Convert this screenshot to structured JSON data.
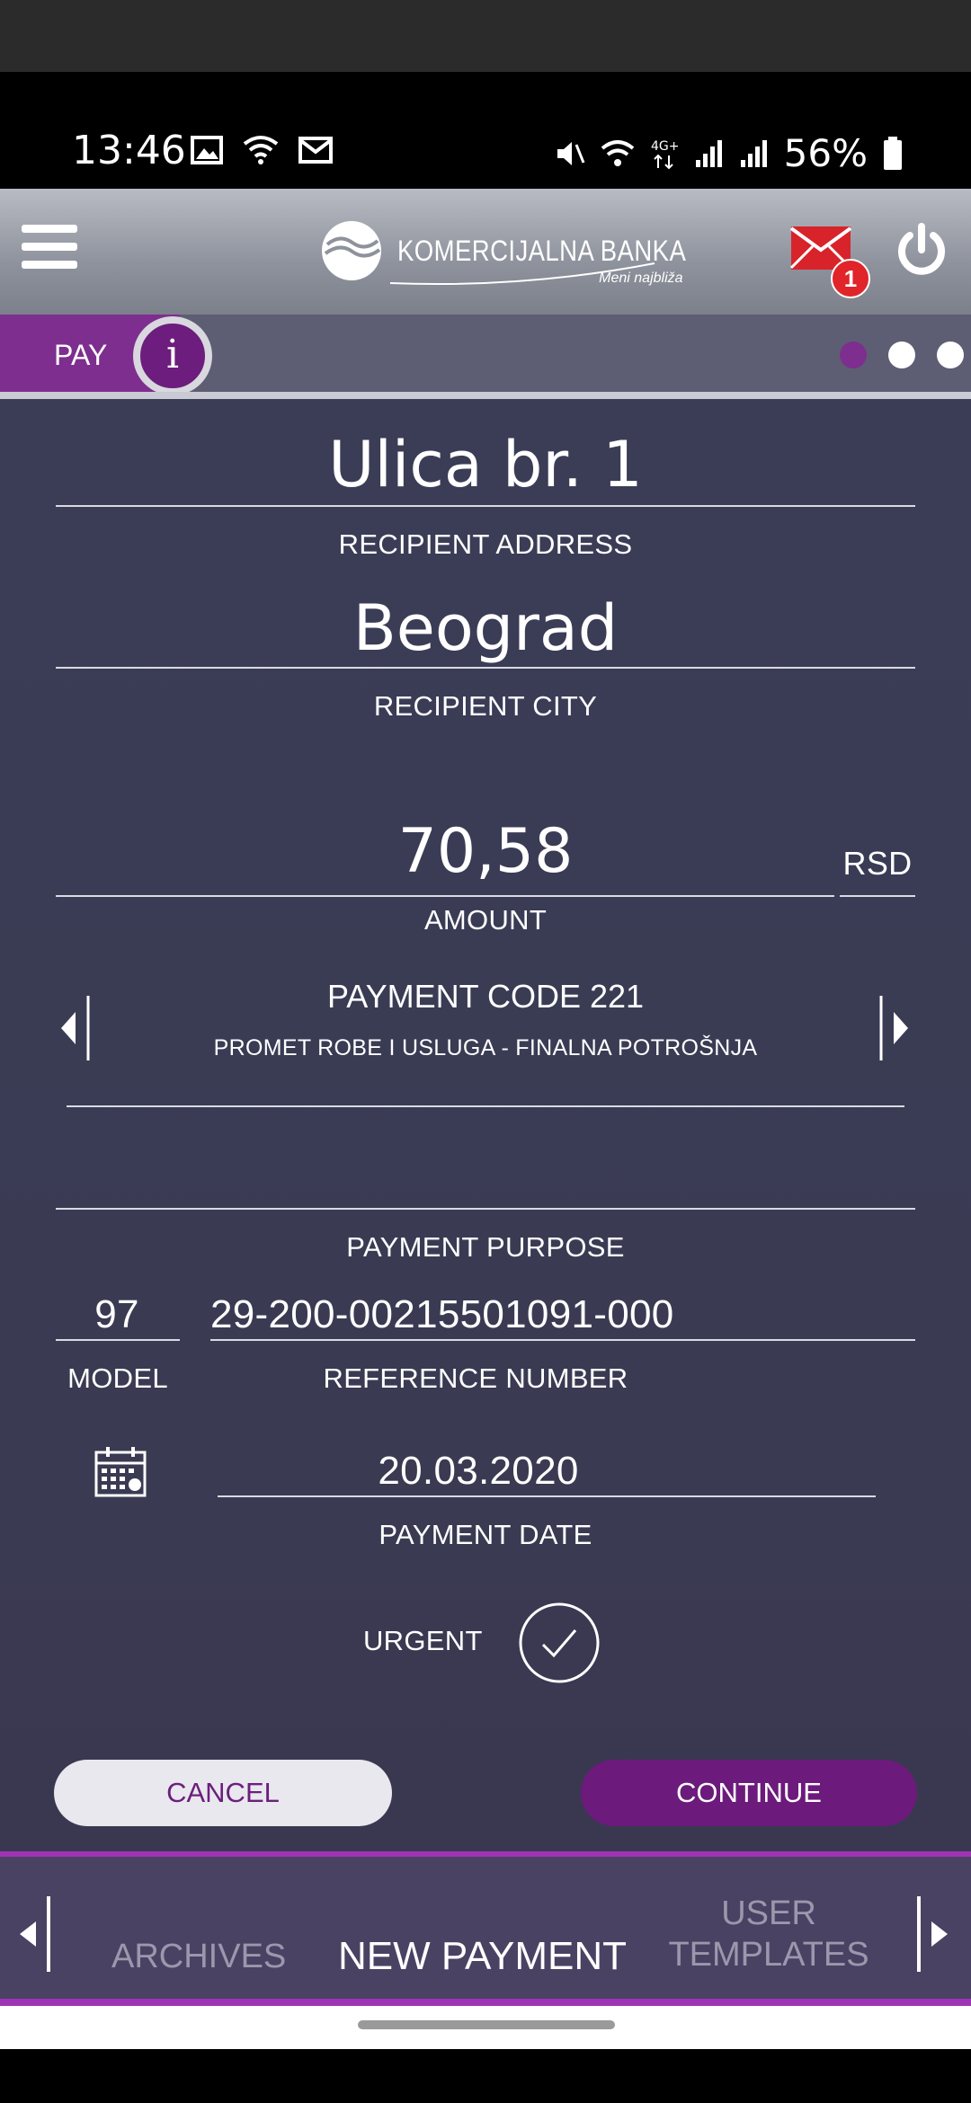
{
  "status_bar": {
    "time": "13:46",
    "battery": "56%",
    "icons_left": [
      "image-icon",
      "wifi-calling-icon",
      "email-icon"
    ],
    "icons_right": [
      "mute-icon",
      "wifi-icon",
      "4g-icon",
      "signal-icon",
      "signal-icon",
      "battery-icon"
    ]
  },
  "header": {
    "logo_name": "KOMERCIJALNA BANKA",
    "logo_tagline": "Meni najbliža",
    "mail_badge": "1"
  },
  "pay_bar": {
    "label": "PAY",
    "info_glyph": "i",
    "page_count": 3,
    "active_page": 1
  },
  "form": {
    "recipient_address": {
      "value": "Ulica br. 1",
      "label": "RECIPIENT ADDRESS"
    },
    "recipient_city": {
      "value": "Beograd",
      "label": "RECIPIENT CITY"
    },
    "amount": {
      "value": "70,58",
      "currency": "RSD",
      "label": "AMOUNT"
    },
    "payment_code": {
      "title": "PAYMENT CODE 221",
      "description": "PROMET ROBE I USLUGA - FINALNA POTROŠNJA"
    },
    "payment_purpose": {
      "value": "",
      "label": "PAYMENT PURPOSE"
    },
    "model": {
      "value": "97",
      "label": "MODEL"
    },
    "reference_number": {
      "value": "29-200-00215501091-000",
      "label": "REFERENCE NUMBER"
    },
    "payment_date": {
      "value": "20.03.2020",
      "label": "PAYMENT DATE"
    },
    "urgent": {
      "label": "URGENT",
      "checked": true
    }
  },
  "buttons": {
    "cancel": "CANCEL",
    "continue": "CONTINUE"
  },
  "bottom_nav": {
    "archives": "ARCHIVES",
    "new_payment": "NEW PAYMENT",
    "user_templates_line1": "USER",
    "user_templates_line2": "TEMPLATES"
  },
  "colors": {
    "accent": "#7e2e8f",
    "background": "#3b3d57",
    "badge": "#e0242a"
  }
}
